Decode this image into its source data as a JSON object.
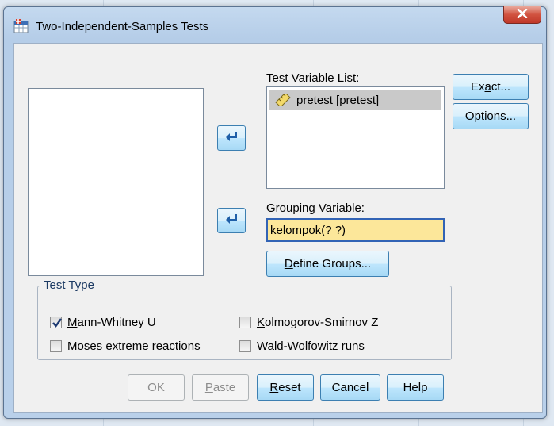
{
  "window": {
    "title": "Two-Independent-Samples Tests",
    "close_icon": "close-x-icon",
    "app_icon": "spss-dialog-icon"
  },
  "source_list": {
    "items": []
  },
  "test_variable_list": {
    "label_prefix": "",
    "label_mnemonic": "T",
    "label_rest": "est Variable List:",
    "items": [
      {
        "icon": "ruler-scale-icon",
        "label": "pretest [pretest]",
        "selected": true
      }
    ]
  },
  "grouping_variable": {
    "label_mnemonic": "G",
    "label_rest": "rouping Variable:",
    "value": "kelompok(? ?)"
  },
  "define_groups_button": {
    "mnemonic": "D",
    "rest": "efine Groups..."
  },
  "side_buttons": {
    "exact": {
      "prefix": "Ex",
      "mnemonic": "a",
      "rest": "ct..."
    },
    "options": {
      "mnemonic": "O",
      "rest": "ptions..."
    }
  },
  "test_type": {
    "legend": "Test Type",
    "options": [
      {
        "mnemonic": "M",
        "rest": "ann-Whitney U",
        "prefix": "",
        "checked": true
      },
      {
        "prefix": "",
        "mnemonic": "K",
        "rest": "olmogorov-Smirnov Z",
        "checked": false
      },
      {
        "prefix": "Mo",
        "mnemonic": "s",
        "rest": "es extreme reactions",
        "checked": false
      },
      {
        "prefix": "",
        "mnemonic": "W",
        "rest": "ald-Wolfowitz runs",
        "checked": false
      }
    ]
  },
  "bottom_buttons": {
    "ok": "OK",
    "paste_mnemonic": "P",
    "paste_rest": "aste",
    "reset_mnemonic": "R",
    "reset_rest": "eset",
    "cancel": "Cancel",
    "help": "Help"
  },
  "colors": {
    "grouping_highlight": "#fce79a",
    "selected_item": "#c9c9c9",
    "close_button": "#c0382a",
    "arrow_button": "#1f5fa8"
  }
}
